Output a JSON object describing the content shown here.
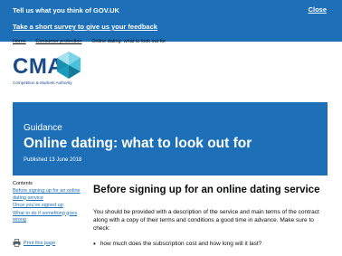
{
  "banner": {
    "title": "Tell us what you think of GOV.UK",
    "survey_link": "Take a short survey to give us your feedback",
    "close_label": "Close"
  },
  "breadcrumb": {
    "items": [
      "Home",
      "Consumer protection"
    ],
    "current": "Online dating: what to look out for"
  },
  "logo": {
    "abbr": "CMA",
    "name": "Competition & Markets Authority"
  },
  "header": {
    "caption": "Guidance",
    "title": "Online dating: what to look out for",
    "published": "Published 13 June 2018"
  },
  "sidebar": {
    "heading": "Contents",
    "links": [
      "Before signing up for an online dating service",
      "Once you've signed up",
      "What to do if something goes wrong"
    ],
    "print_label": "Print this page"
  },
  "main": {
    "heading": "Before signing up for an online dating service",
    "paragraph": "You should be provided with a description of the service and main terms of the contract along with a copy of their terms and conditions a good time in advance. Make sure to check:",
    "bullets": [
      "how much does the subscription cost and how long will it last?"
    ]
  },
  "colors": {
    "brand_blue": "#1d70b8",
    "cma_navy": "#1a4a8a",
    "cma_teal": "#2fb4d1",
    "text": "#0b0c0c"
  }
}
